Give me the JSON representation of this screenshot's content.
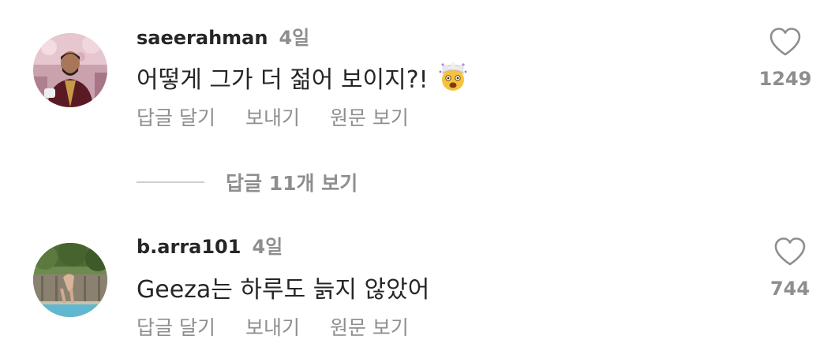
{
  "comments": [
    {
      "username": "saeerahman",
      "time": "4일",
      "text": "어떻게 그가 더 젊어 보이지?!",
      "emoji_icon": "exploding-head-icon",
      "actions": {
        "reply": "답글 달기",
        "send": "보내기",
        "see_original": "원문 보기"
      },
      "like_count": "1249"
    },
    {
      "username": "b.arra101",
      "time": "4일",
      "text": "Geeza는 하루도 늙지 않았어",
      "actions": {
        "reply": "답글 달기",
        "send": "보내기",
        "see_original": "원문 보기"
      },
      "like_count": "744"
    }
  ],
  "view_replies": "답글 11개 보기",
  "colors": {
    "primary_text": "#262626",
    "secondary_text": "#8e8e8e",
    "divider": "#cfcfcf"
  }
}
